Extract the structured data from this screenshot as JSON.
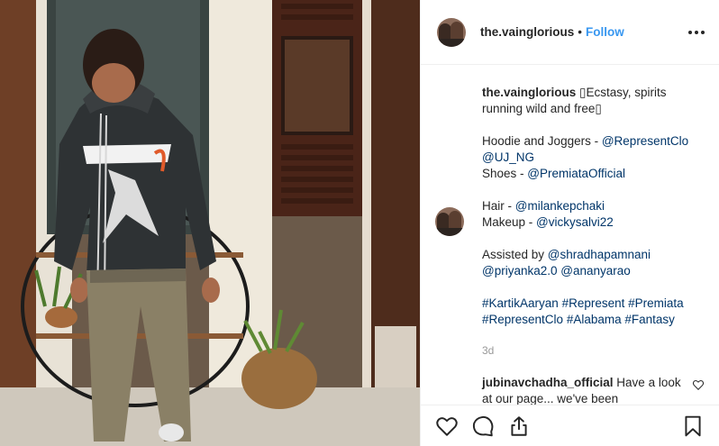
{
  "header": {
    "username": "the.vainglorious",
    "separator": "•",
    "follow_label": "Follow",
    "more_icon": "more-horizontal-icon"
  },
  "caption": {
    "username": "the.vainglorious",
    "line1": " \u0000Ecstasy, spirits running wild and free\u0000",
    "hoodie_prefix": "Hoodie and Joggers - ",
    "hoodie_link1": "@RepresentClo",
    "hoodie_link2": "@UJ_NG",
    "shoes_prefix": "Shoes - ",
    "shoes_link": "@PremiataOfficial",
    "hair_prefix": "Hair - ",
    "hair_link": "@milankepchaki",
    "makeup_prefix": "Makeup - ",
    "makeup_link": "@vickysalvi22",
    "assisted_prefix": "Assisted by ",
    "assisted_link1": "@shradhapamnani",
    "assisted_link2": "@priyanka2.0",
    "assisted_link3": "@ananyarao",
    "tags_line1": [
      "#KartikAaryan",
      "#Represent",
      "#Premiata"
    ],
    "tags_line2": [
      "#RepresentClo",
      "#Alabama",
      "#Fantasy"
    ]
  },
  "timestamp": "3d",
  "comment": {
    "username": "jubinavchadha_official",
    "text": " Have a look at our page... we've been"
  },
  "actions": {
    "like": "heart-icon",
    "comment": "comment-icon",
    "share": "share-icon",
    "save": "bookmark-icon"
  },
  "colors": {
    "link": "#003569",
    "follow": "#3897f0",
    "muted": "#999999"
  }
}
